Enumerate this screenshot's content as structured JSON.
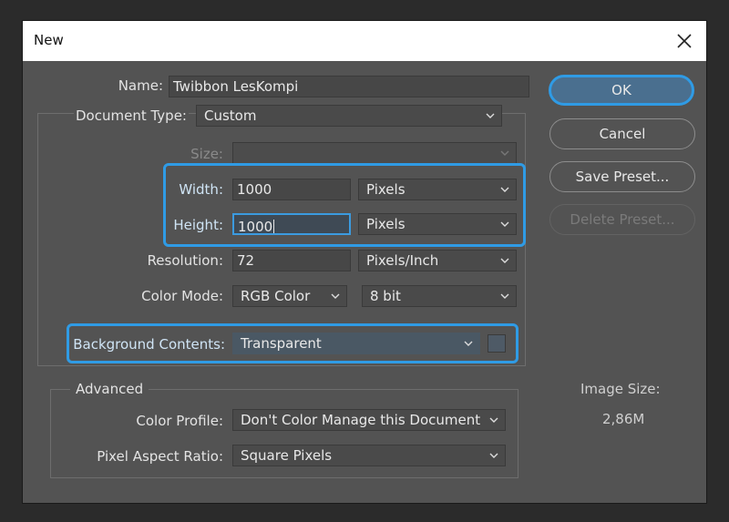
{
  "dialog": {
    "title": "New"
  },
  "fields": {
    "name_label": "Name:",
    "name_value": "Twibbon LesKompi",
    "doc_type_label": "Document Type:",
    "doc_type_value": "Custom",
    "size_label": "Size:",
    "width_label": "Width:",
    "width_value": "1000",
    "width_unit": "Pixels",
    "height_label": "Height:",
    "height_value": "1000",
    "height_unit": "Pixels",
    "resolution_label": "Resolution:",
    "resolution_value": "72",
    "resolution_unit": "Pixels/Inch",
    "color_mode_label": "Color Mode:",
    "color_mode_value": "RGB Color",
    "bit_depth_value": "8 bit",
    "bg_label": "Background Contents:",
    "bg_value": "Transparent"
  },
  "advanced": {
    "title": "Advanced",
    "profile_label": "Color Profile:",
    "profile_value": "Don't Color Manage this Document",
    "aspect_label": "Pixel Aspect Ratio:",
    "aspect_value": "Square Pixels"
  },
  "buttons": {
    "ok": "OK",
    "cancel": "Cancel",
    "save_preset": "Save Preset...",
    "delete_preset": "Delete Preset..."
  },
  "image_size": {
    "label": "Image Size:",
    "value": "2,86M"
  },
  "colors": {
    "highlight": "#2f9be5",
    "dialog_bg": "#535353"
  },
  "icons": {
    "close": "close-icon",
    "chevron": "chevron-down-icon"
  }
}
